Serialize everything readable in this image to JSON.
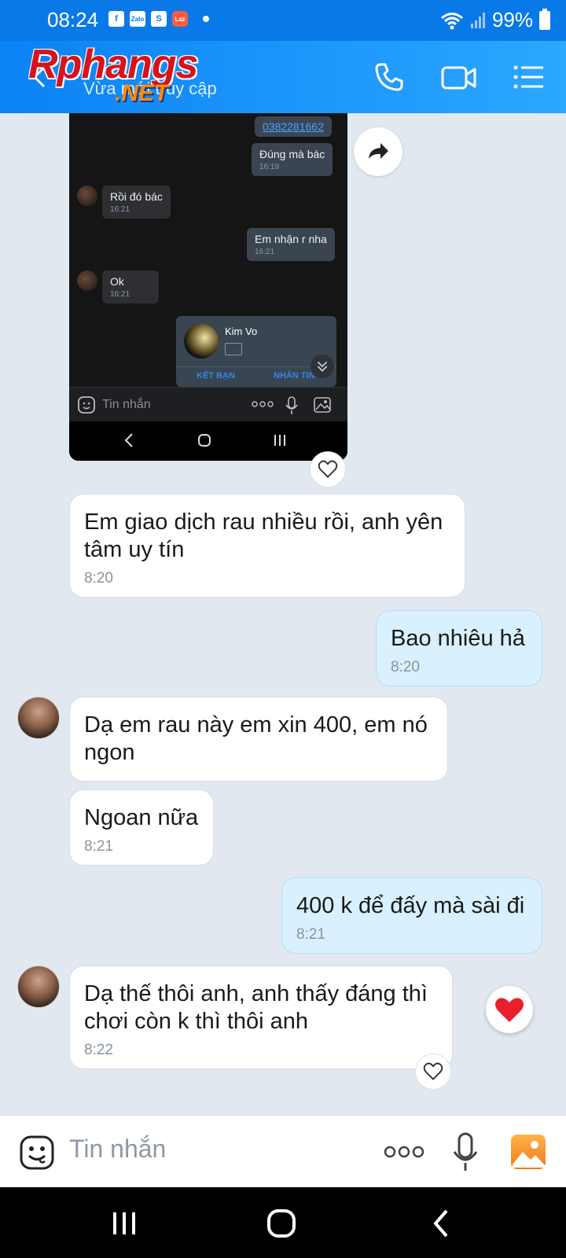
{
  "status_bar": {
    "time": "08:24",
    "notifications": [
      "facebook-icon",
      "zalo-icon",
      "shopee-icon",
      "lazada-icon"
    ],
    "notif_zalo": "Zalo",
    "notif_shopee": "S",
    "notif_lazada": "Laz",
    "battery": "99%"
  },
  "header": {
    "logo_main": "Rphangs",
    "logo_net": ".NET",
    "subtitle": "Vừa mới truy cập"
  },
  "embedded_screenshot": {
    "messages": [
      {
        "side": "out",
        "text": "0382281662",
        "time": "",
        "is_link": true
      },
      {
        "side": "out",
        "text": "Đúng mà bác",
        "time": "16:19"
      },
      {
        "side": "in",
        "text": "Rồi đó bác",
        "time": "16:21"
      },
      {
        "side": "out",
        "text": "Em nhận r nha",
        "time": "16:21"
      },
      {
        "side": "in",
        "text": "Ok",
        "time": "16:21"
      }
    ],
    "contact_card": {
      "name": "Kim Vo",
      "btn_add": "KẾT BẠN",
      "btn_message": "NHẮN TIN"
    },
    "input_placeholder": "Tin nhắn"
  },
  "chat": {
    "messages": [
      {
        "side": "in",
        "text": "Em giao dịch rau nhiều rồi, anh yên tâm uy tín",
        "time": "8:20"
      },
      {
        "side": "out",
        "text": "Bao nhiêu hả",
        "time": "8:20"
      },
      {
        "side": "in",
        "text": "Dạ em rau này em xin 400, em nó ngon",
        "time": ""
      },
      {
        "side": "in",
        "text": "Ngoan nữa",
        "time": "8:21"
      },
      {
        "side": "out",
        "text": "400 k để đấy mà sài đi",
        "time": "8:21"
      },
      {
        "side": "in",
        "text": "Dạ thế thôi anh, anh thấy đáng thì chơi còn k thì thôi anh",
        "time": "8:22"
      }
    ]
  },
  "composer": {
    "placeholder": "Tin nhắn"
  },
  "colors": {
    "header_blue": "#0b82f5",
    "incoming_bubble": "#ffffff",
    "outgoing_bubble": "#d9f0ff",
    "heart": "#e8202e"
  }
}
